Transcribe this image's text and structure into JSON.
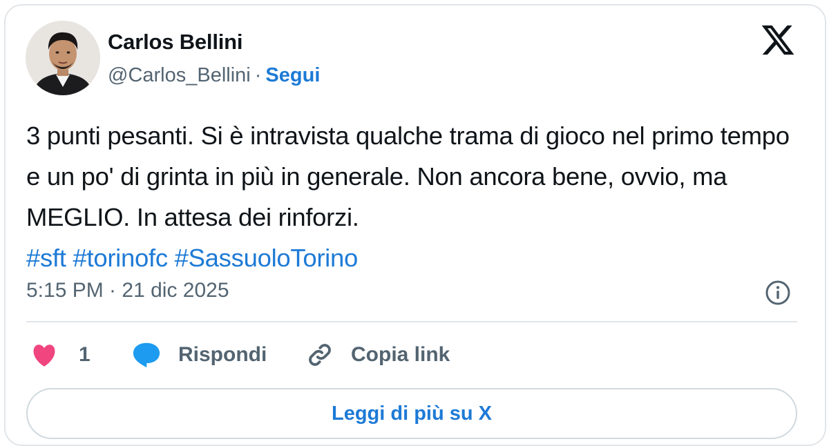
{
  "author": {
    "name": "Carlos Bellini",
    "handle": "@Carlos_Bellini",
    "separator": "·",
    "follow_label": "Segui"
  },
  "tweet": {
    "text": "3 punti pesanti. Si è intravista qualche trama di gioco nel primo tempo e un po' di grinta in più in generale. Non ancora bene, ovvio, ma MEGLIO. In attesa dei rinforzi.",
    "hashtags": [
      "#sft",
      "#torinofc",
      "#SassuoloTorino"
    ]
  },
  "meta": {
    "timestamp": "5:15 PM · 21 dic 2025"
  },
  "actions": {
    "like_count": "1",
    "reply_label": "Rispondi",
    "copy_link_label": "Copia link"
  },
  "read_more_label": "Leggi di più su X",
  "icons": {
    "brand": "x-logo-icon",
    "info": "info-icon",
    "like": "heart-icon",
    "reply": "speech-bubble-icon",
    "copy": "link-icon"
  },
  "colors": {
    "link": "#1d7ad6",
    "heart": "#f0457e",
    "reply_bubble": "#1d9bf0",
    "secondary_text": "#536471",
    "border": "#e1e5e9"
  }
}
